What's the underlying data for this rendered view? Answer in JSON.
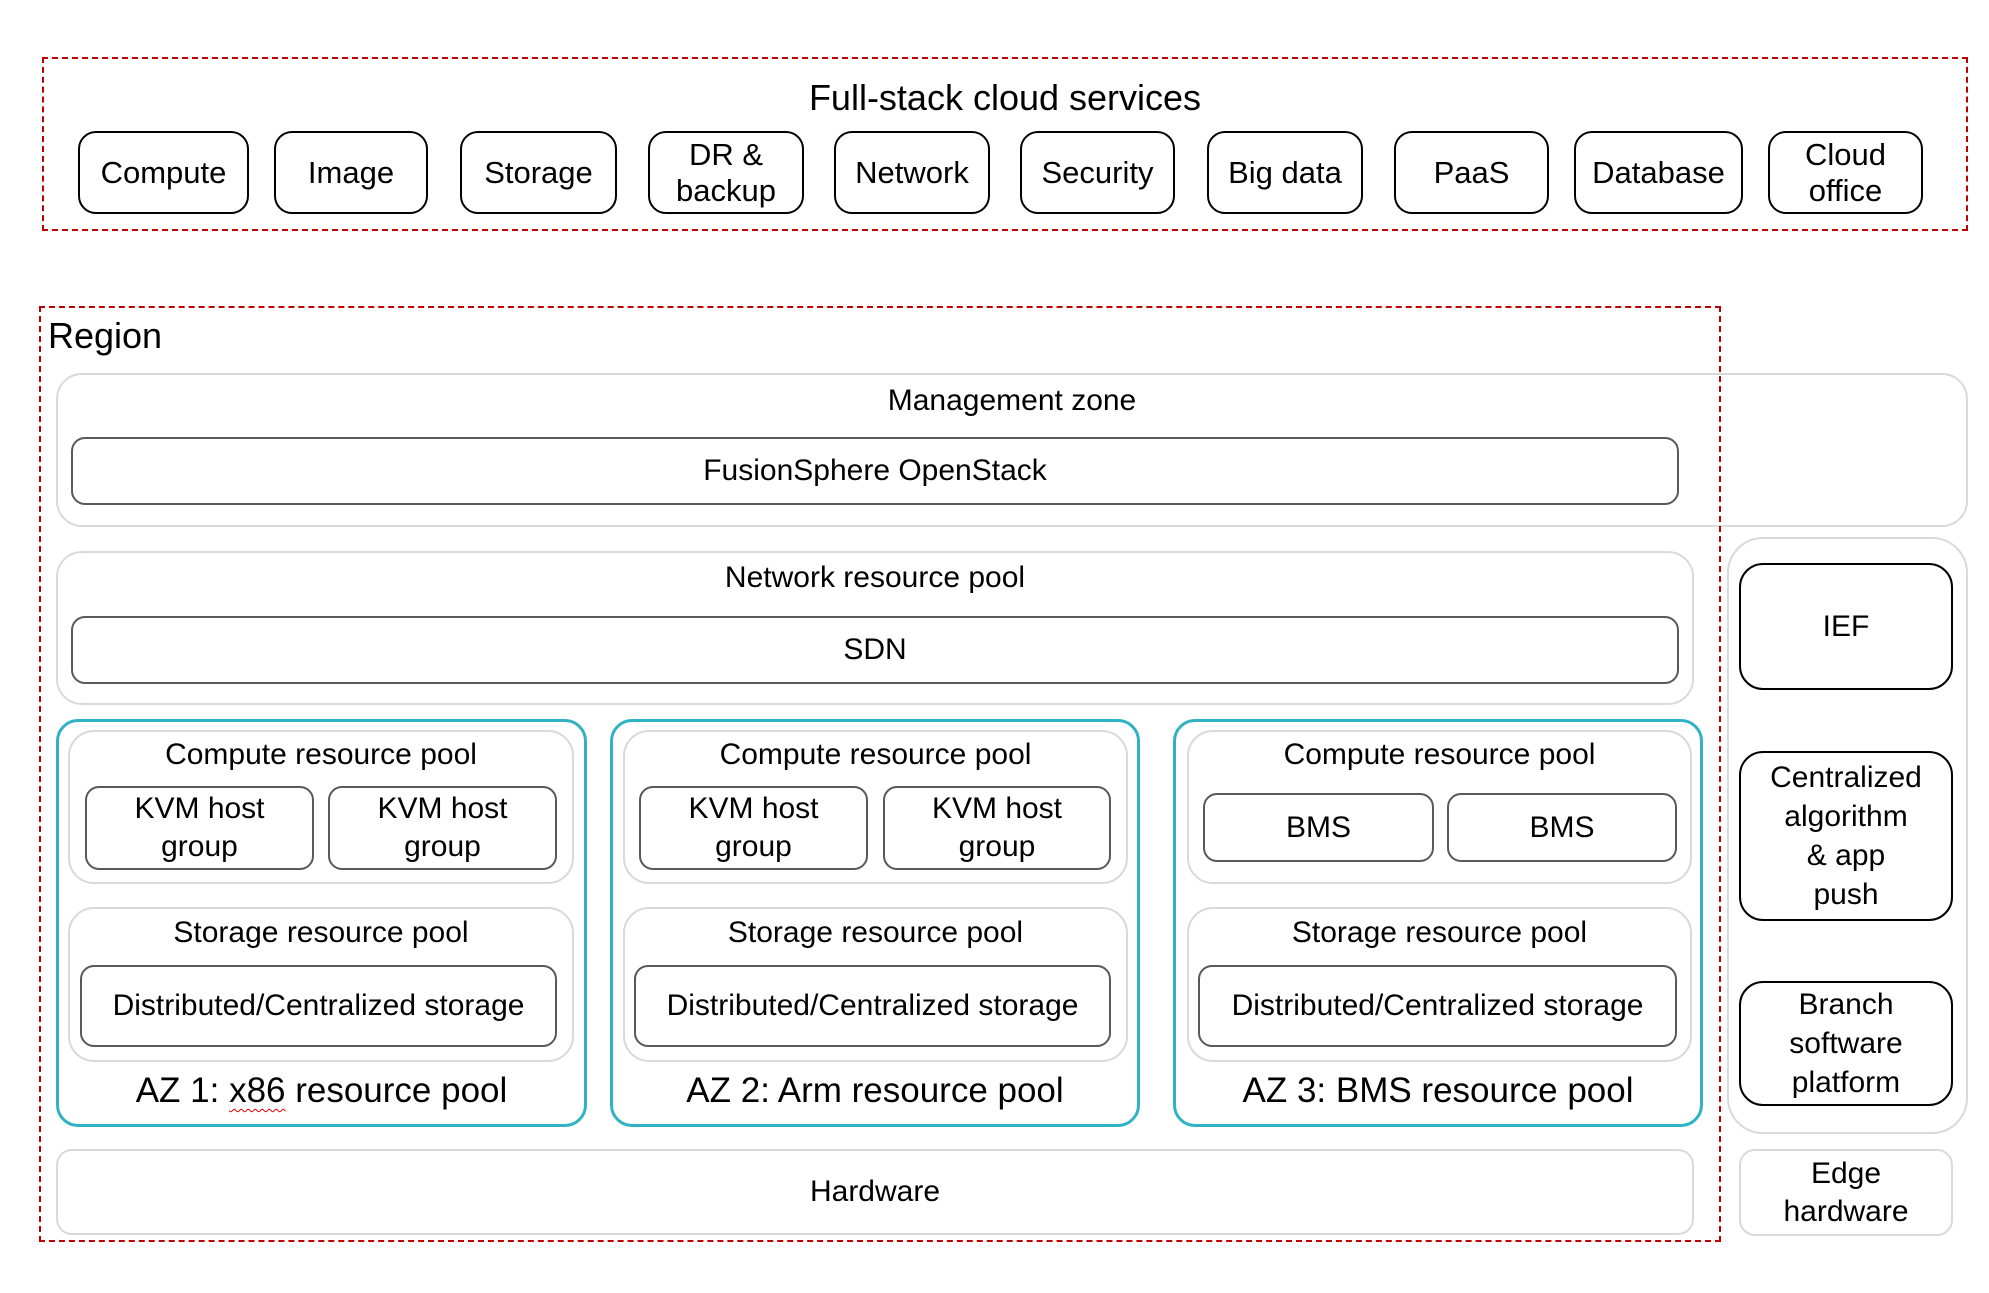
{
  "cloud_services": {
    "title": "Full-stack cloud services",
    "items": [
      {
        "label": "Compute"
      },
      {
        "label": "Image"
      },
      {
        "label": "Storage"
      },
      {
        "label": "DR &\nbackup"
      },
      {
        "label": "Network"
      },
      {
        "label": "Security"
      },
      {
        "label": "Big data"
      },
      {
        "label": "PaaS"
      },
      {
        "label": "Database"
      },
      {
        "label": "Cloud\noffice"
      }
    ]
  },
  "region": {
    "title": "Region",
    "management_zone": {
      "title": "Management zone",
      "component": "FusionSphere OpenStack"
    },
    "network_pool": {
      "title": "Network resource pool",
      "component": "SDN"
    },
    "azs": [
      {
        "title_prefix": "AZ 1: ",
        "title_squiggle": "x86",
        "title_suffix": " resource pool",
        "compute_title": "Compute resource pool",
        "compute_items": [
          "KVM host\ngroup",
          "KVM host\ngroup"
        ],
        "storage_title": "Storage resource pool",
        "storage_item": "Distributed/Centralized storage"
      },
      {
        "title": "AZ 2: Arm resource pool",
        "compute_title": "Compute resource pool",
        "compute_items": [
          "KVM host\ngroup",
          "KVM host\ngroup"
        ],
        "storage_title": "Storage resource pool",
        "storage_item": "Distributed/Centralized storage"
      },
      {
        "title": "AZ 3: BMS resource pool",
        "compute_title": "Compute resource pool",
        "compute_items": [
          "BMS",
          "BMS"
        ],
        "storage_title": "Storage resource pool",
        "storage_item": "Distributed/Centralized storage"
      }
    ],
    "hardware": "Hardware"
  },
  "edge": {
    "items": [
      "IEF",
      "Centralized\nalgorithm\n& app\npush",
      "Branch\nsoftware\nplatform"
    ],
    "hardware": "Edge\nhardware"
  },
  "colors": {
    "dashed_border": "#c00000",
    "az_border": "#2fb3c4",
    "soft_border": "#d9d9d9",
    "inner_border": "#595959"
  }
}
